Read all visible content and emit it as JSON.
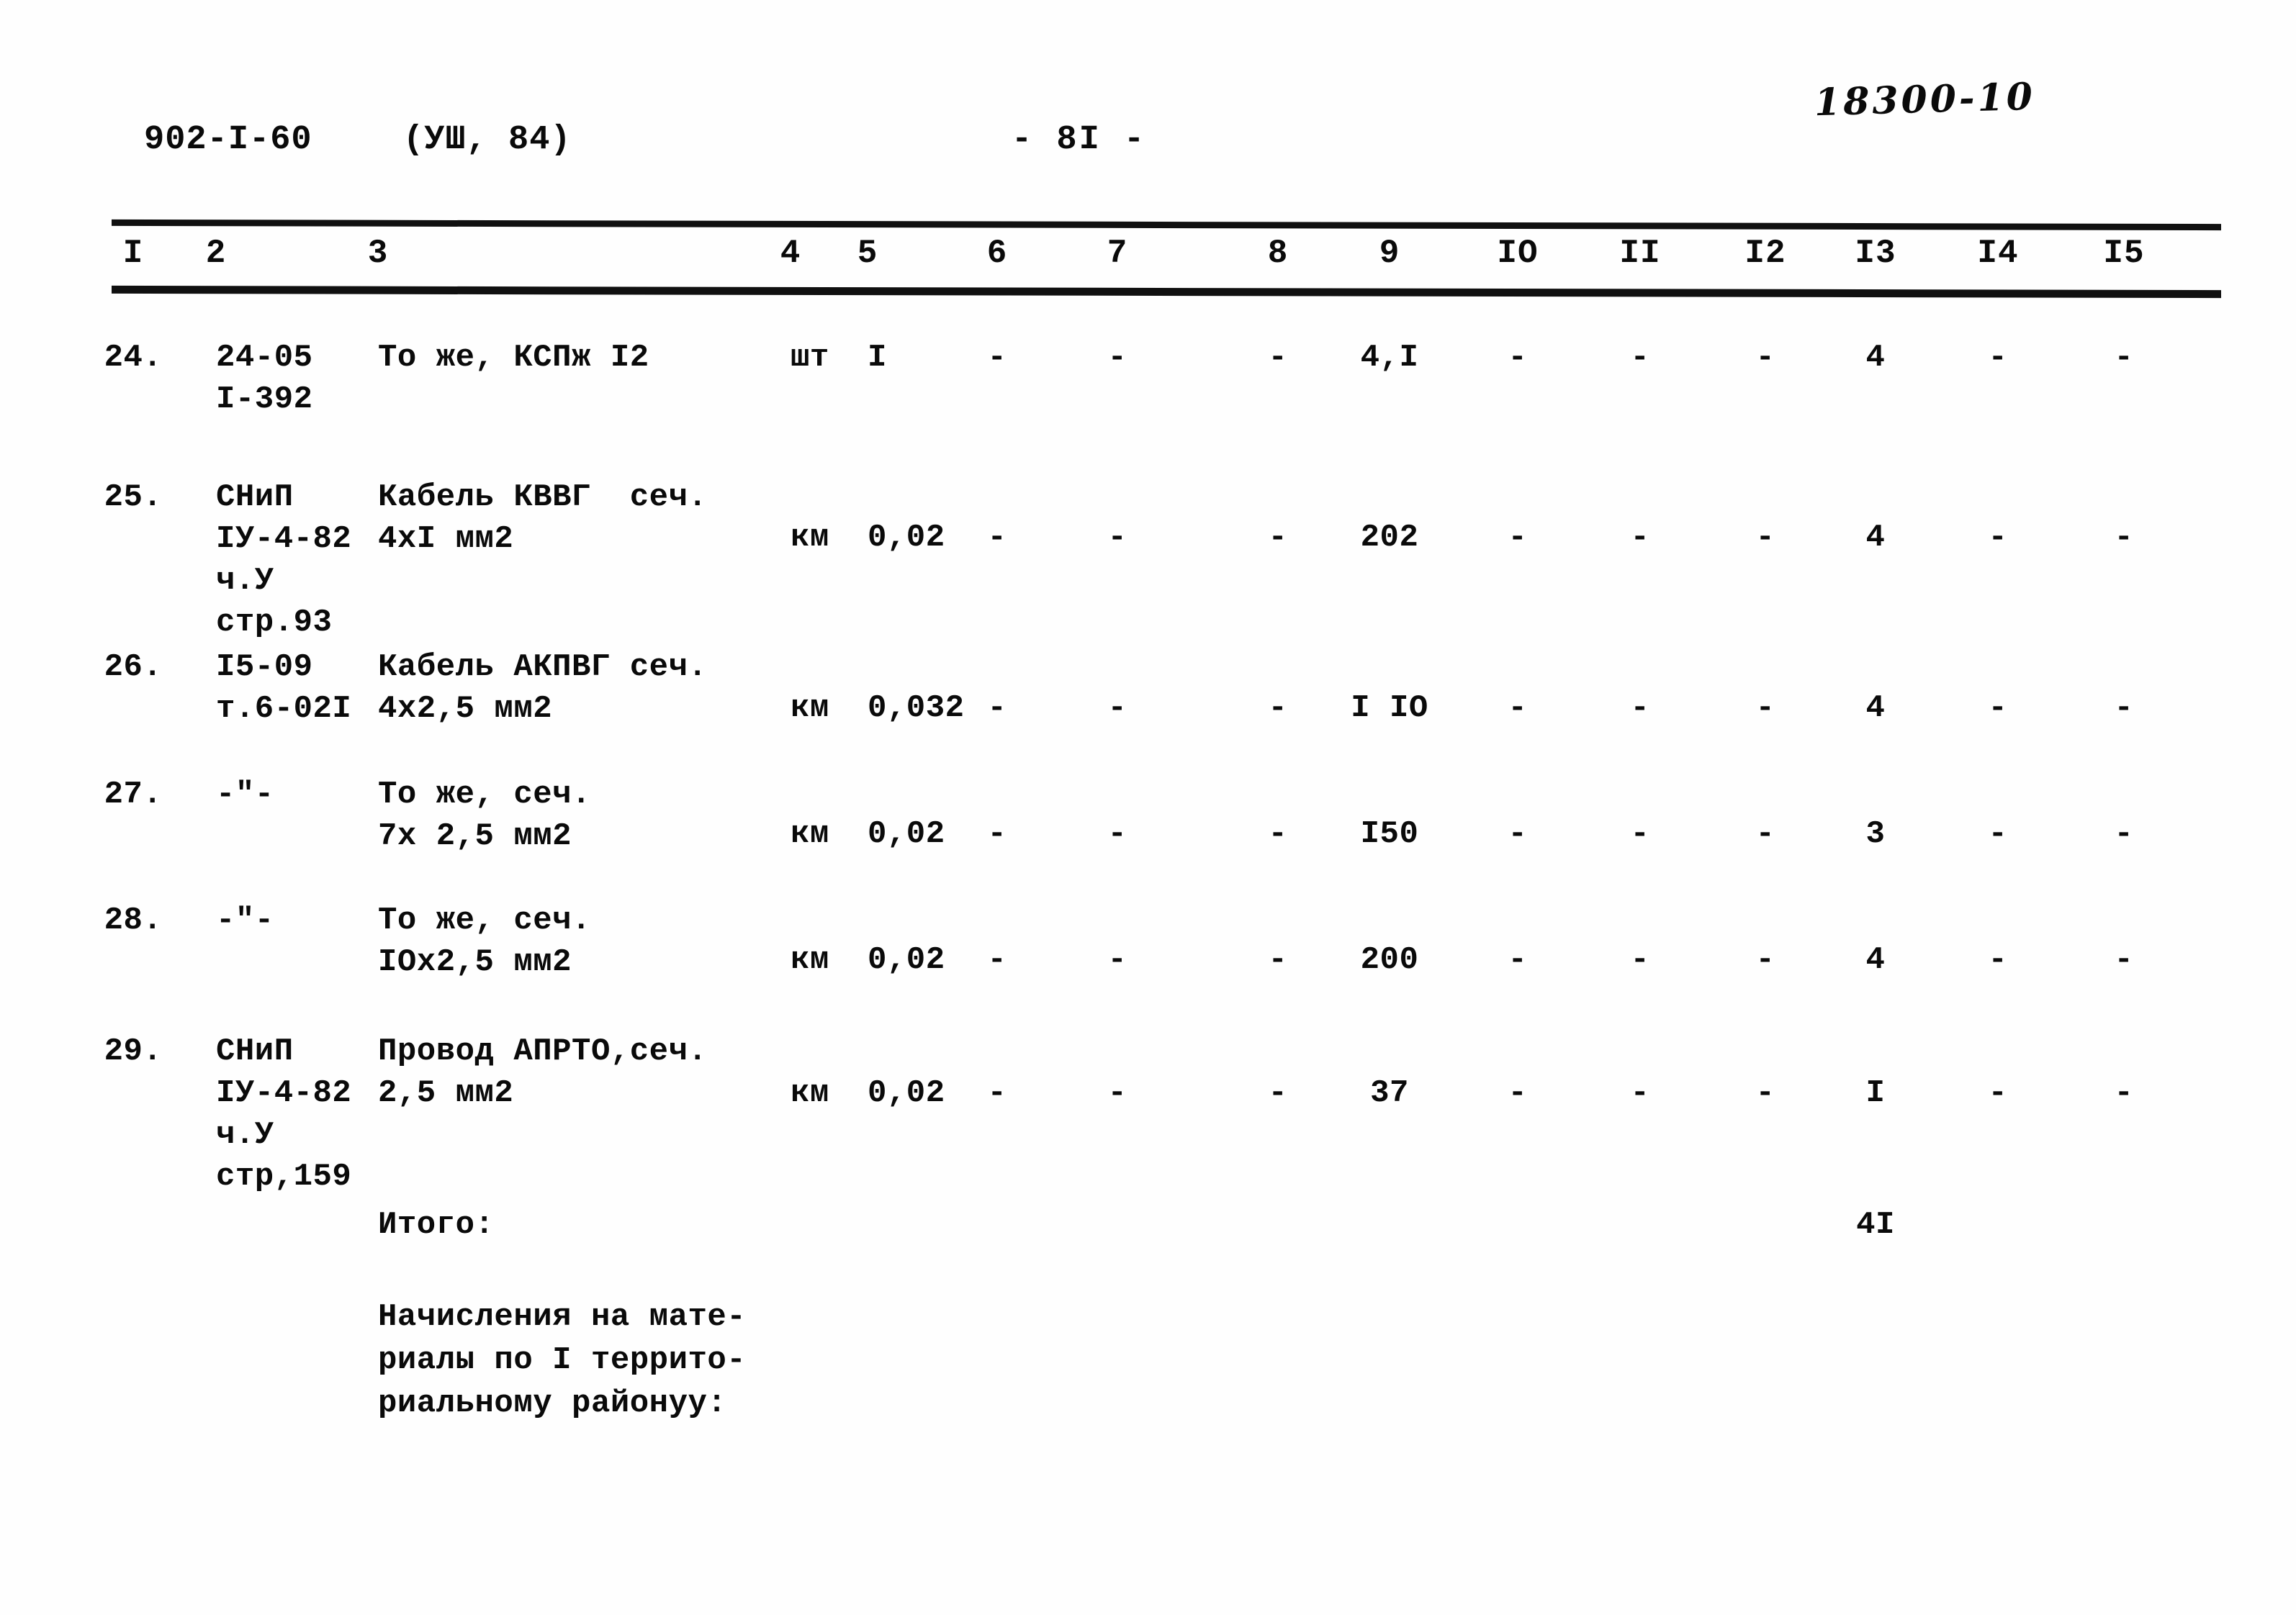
{
  "header": {
    "doc_code": "902-I-60",
    "series": "(УШ, 84)",
    "page_number": "- 8I -",
    "handwritten_note": "18300-10"
  },
  "table": {
    "column_headers": [
      "I",
      "2",
      "3",
      "4",
      "5",
      "6",
      "7",
      "8",
      "9",
      "IO",
      "II",
      "I2",
      "I3",
      "I4",
      "I5"
    ],
    "rows": [
      {
        "num": "24.",
        "code": "24-05\nI-392",
        "name": "То же, КСПж I2",
        "unit": "шт",
        "c5": "I",
        "c6": "-",
        "c7": "-",
        "c8": "-",
        "c9": "4,I",
        "c10": "-",
        "c11": "-",
        "c12": "-",
        "c13": "4",
        "c14": "-",
        "c15": "-"
      },
      {
        "num": "25.",
        "code": "СНиП\nIУ-4-82\nч.У\nстр.93",
        "name": "Кабель КВВГ  сеч.\n4xI мм2",
        "unit": "км",
        "c5": "0,02",
        "c6": "-",
        "c7": "-",
        "c8": "-",
        "c9": "202",
        "c10": "-",
        "c11": "-",
        "c12": "-",
        "c13": "4",
        "c14": "-",
        "c15": "-"
      },
      {
        "num": "26.",
        "code": "I5-09\nт.6-02I",
        "name": "Кабель АКПВГ сеч.\n4x2,5 мм2",
        "unit": "км",
        "c5": "0,032",
        "c6": "-",
        "c7": "-",
        "c8": "-",
        "c9": "I IO",
        "c10": "-",
        "c11": "-",
        "c12": "-",
        "c13": "4",
        "c14": "-",
        "c15": "-"
      },
      {
        "num": "27.",
        "code": "-\"-",
        "name": "То же, сеч.\n7х 2,5 мм2",
        "unit": "км",
        "c5": "0,02",
        "c6": "-",
        "c7": "-",
        "c8": "-",
        "c9": "I50",
        "c10": "-",
        "c11": "-",
        "c12": "-",
        "c13": "3",
        "c14": "-",
        "c15": "-"
      },
      {
        "num": "28.",
        "code": "-\"-",
        "name": "То же, сеч.\nIOx2,5 мм2",
        "unit": "км",
        "c5": "0,02",
        "c6": "-",
        "c7": "-",
        "c8": "-",
        "c9": "200",
        "c10": "-",
        "c11": "-",
        "c12": "-",
        "c13": "4",
        "c14": "-",
        "c15": "-"
      },
      {
        "num": "29.",
        "code": "СНиП\nIУ-4-82\nч.У\nстр,159",
        "name": "Провод АПРТО,сеч.\n2,5 мм2",
        "unit": "км",
        "c5": "0,02",
        "c6": "-",
        "c7": "-",
        "c8": "-",
        "c9": "37",
        "c10": "-",
        "c11": "-",
        "c12": "-",
        "c13": "I",
        "c14": "-",
        "c15": "-"
      }
    ],
    "total_label": "Итого:",
    "total_value": "4I",
    "footnote": "Начисления на мате-\nриалы по I террито-\nриальному районуу:"
  }
}
